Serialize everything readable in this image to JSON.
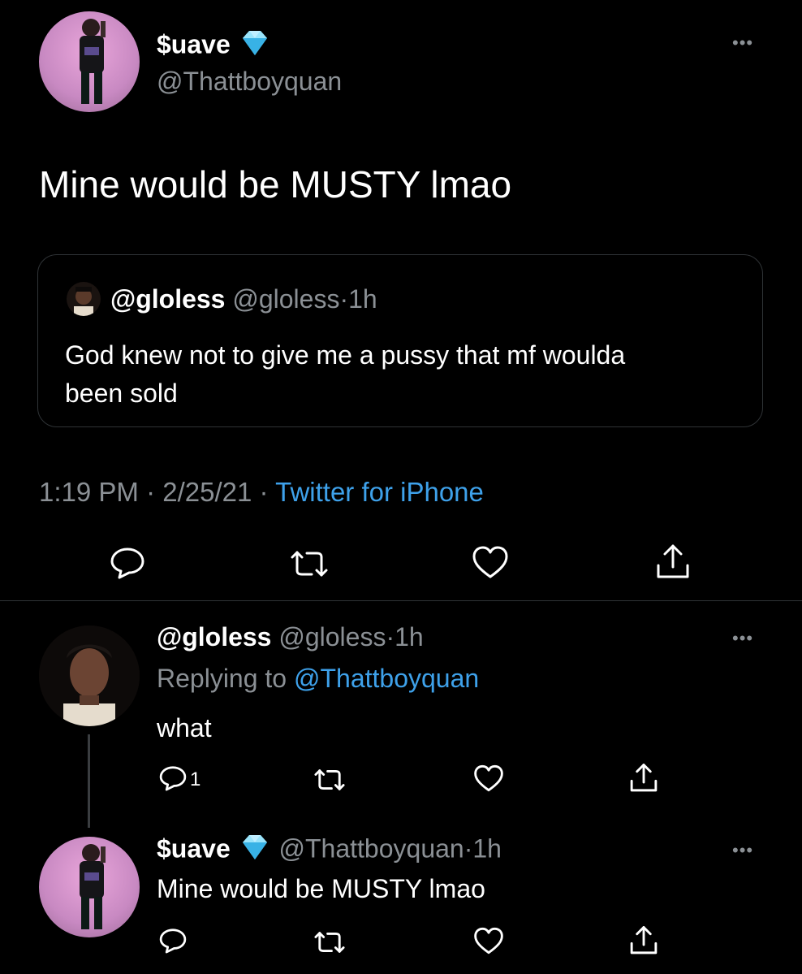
{
  "main_tweet": {
    "display_name": "$uave",
    "verified_icon": "diamond-icon",
    "handle": "@Thattboyquan",
    "text": "Mine would be MUSTY lmao",
    "quoted": {
      "display_name": "@gloless",
      "handle": "@gloless",
      "separator": "·",
      "time": "1h",
      "text_line1": "God knew not to give me a pussy that mf woulda",
      "text_line2": "been sold"
    },
    "meta": {
      "time": "1:19 PM",
      "sep1": "·",
      "date": "2/25/21",
      "sep2": "·",
      "source": "Twitter for iPhone"
    },
    "actions": [
      "reply-icon",
      "retweet-icon",
      "like-icon",
      "share-icon"
    ]
  },
  "reply1": {
    "display_name": "@gloless",
    "handle": "@gloless",
    "separator": "·",
    "time": "1h",
    "replying_prefix": "Replying to",
    "replying_to": "@Thattboyquan",
    "text": "what",
    "reply_count": "1"
  },
  "reply2": {
    "display_name": "$uave",
    "handle": "@Thattboyquan",
    "separator": "·",
    "time": "1h",
    "text": "Mine would be MUSTY lmao"
  },
  "colors": {
    "background": "#000000",
    "text": "#ffffff",
    "muted": "#8b9095",
    "link": "#3ea1ea",
    "divider": "#2f3336"
  },
  "more_label": "•••"
}
